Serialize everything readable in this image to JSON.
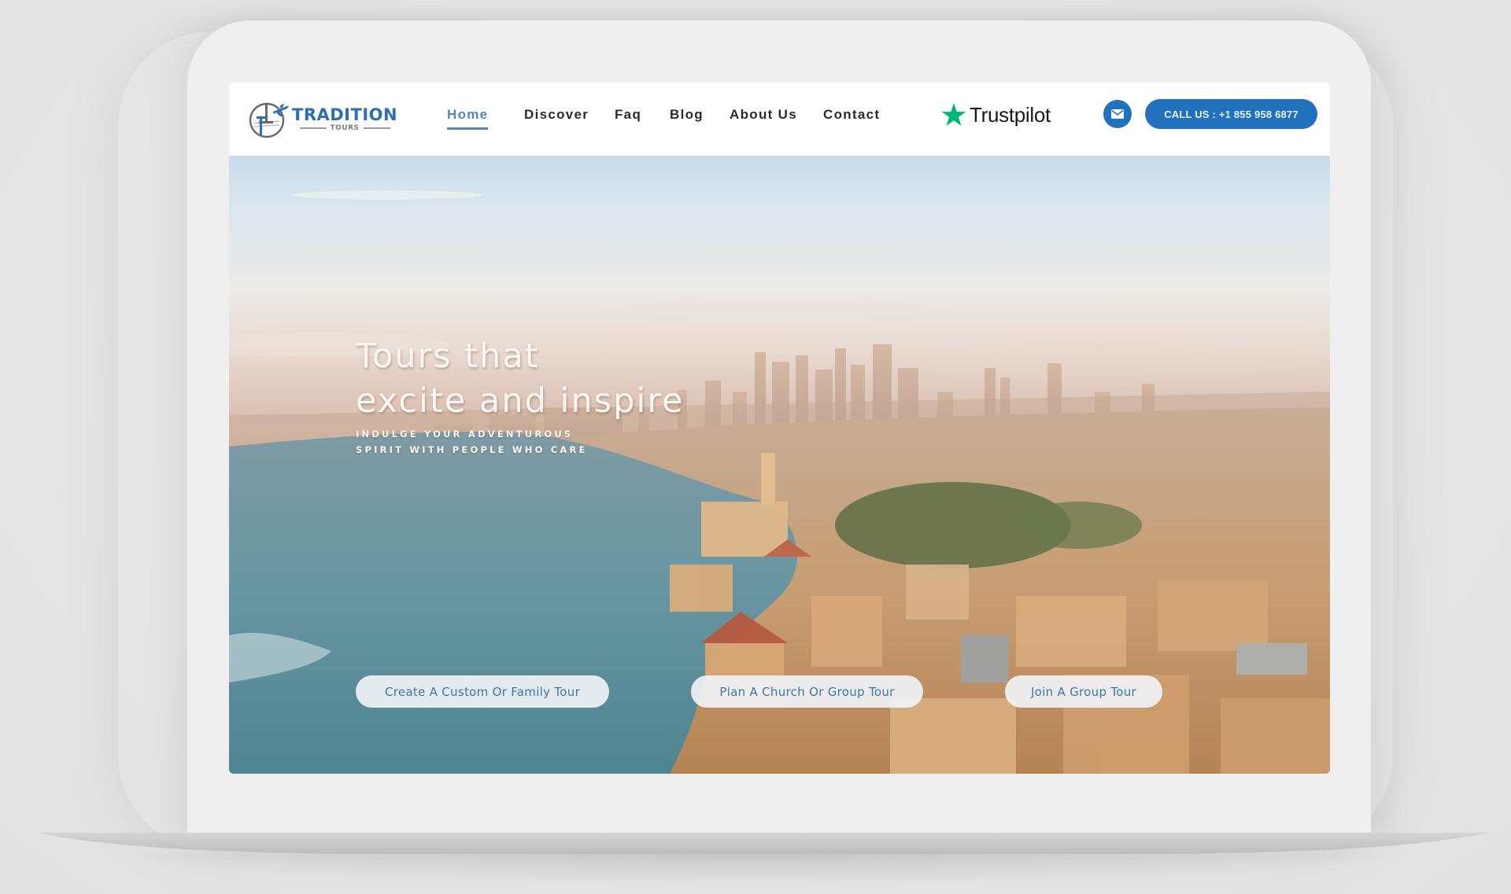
{
  "logo": {
    "title": "TRADITION",
    "subtitle": "TOURS"
  },
  "nav": {
    "items": [
      {
        "label": "Home",
        "active": true
      },
      {
        "label": "Discover",
        "active": false
      },
      {
        "label": "Faq",
        "active": false
      },
      {
        "label": "Blog",
        "active": false
      },
      {
        "label": "About Us",
        "active": false
      },
      {
        "label": "Contact",
        "active": false
      }
    ]
  },
  "trustpilot": {
    "label": "Trustpilot",
    "star_color": "#00b67a"
  },
  "contact": {
    "mail_icon": "envelope-icon",
    "call_label": "CALL US : +1 855 958 6877"
  },
  "hero": {
    "headline_line1": "Tours that",
    "headline_line2": "excite and inspire",
    "subtitle_line1": "INDULGE YOUR ADVENTUROUS",
    "subtitle_line2": "SPIRIT WITH PEOPLE WHO CARE",
    "buttons": [
      {
        "label": "Create A Custom Or Family Tour"
      },
      {
        "label": "Plan A Church Or Group Tour"
      },
      {
        "label": "Join A Group Tour"
      }
    ]
  },
  "colors": {
    "brand_blue": "#2271bd",
    "nav_active": "#4f86b8",
    "cta_text": "#3d77b0"
  }
}
